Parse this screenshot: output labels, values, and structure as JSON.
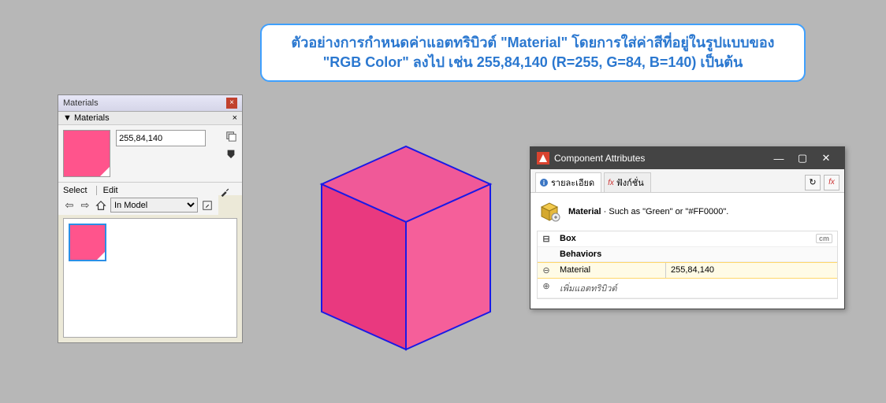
{
  "callout": {
    "line1": "ตัวอย่างการกำหนดค่าแอตทริบิวต์ \"Material\" โดยการใส่ค่าสีที่อยู่ในรูปแบบของ",
    "line2": "\"RGB Color\" ลงไป เช่น 255,84,140 (R=255, G=84, B=140) เป็นต้น"
  },
  "materials": {
    "title": "Materials",
    "dropdown_label": "▼  Materials",
    "color_value": "255,84,140",
    "swatch_rgb": "#ff548c",
    "tab_select": "Select",
    "tab_edit": "Edit",
    "filter_value": "In Model"
  },
  "component": {
    "title": "Component Attributes",
    "tab_info": "รายละเอียด",
    "tab_func": "ฟังก์ชั่น",
    "attr_name_bold": "Material",
    "attr_desc": " · Such as \"Green\" or \"#FF0000\".",
    "group_name": "Box",
    "unit_label": "cm",
    "section_behaviors": "Behaviors",
    "row_attr": "Material",
    "row_value": "255,84,140",
    "add_attr": "เพิ่มแอตทริบิวต์"
  }
}
